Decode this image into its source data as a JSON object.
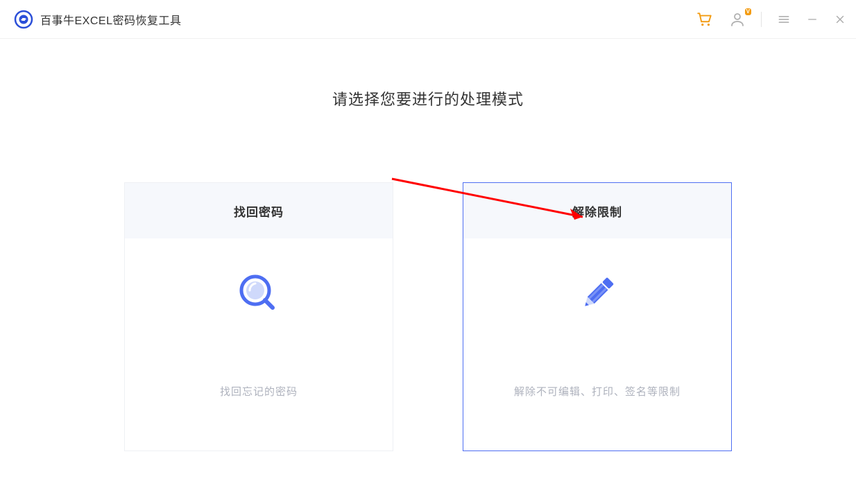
{
  "header": {
    "app_title": "百事牛EXCEL密码恢复工具"
  },
  "main": {
    "page_title": "请选择您要进行的处理模式",
    "cards": {
      "recover": {
        "title": "找回密码",
        "desc": "找回忘记的密码"
      },
      "unlock": {
        "title": "解除限制",
        "desc": "解除不可编辑、打印、签名等限制"
      }
    }
  }
}
